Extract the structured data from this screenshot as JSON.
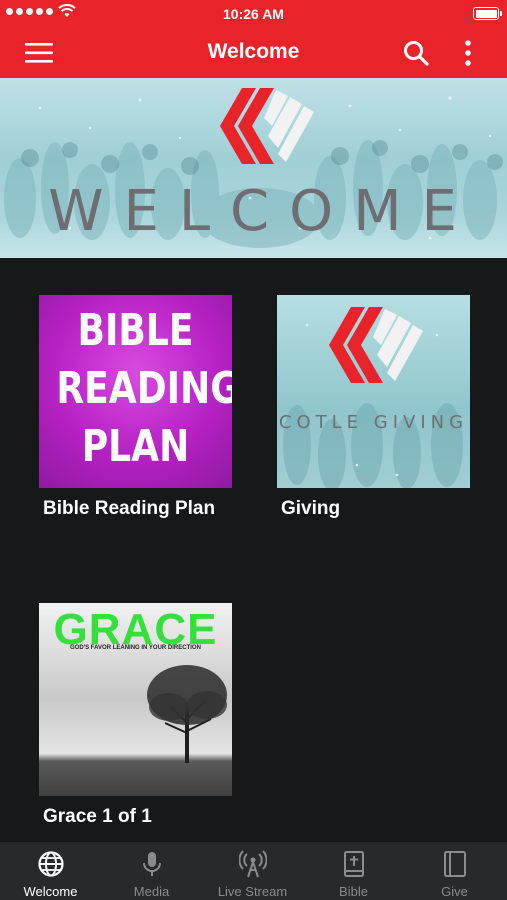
{
  "status_bar": {
    "time": "10:26 AM"
  },
  "app_bar": {
    "title": "Welcome",
    "menu_icon": "hamburger-menu-icon",
    "search_icon": "search-icon",
    "more_icon": "more-vert-icon",
    "color": "#e8232a"
  },
  "hero": {
    "title": "WELCOME",
    "logo_icon": "church-chevron-logo"
  },
  "grid": {
    "items": [
      {
        "label": "Bible Reading Plan",
        "image_lines": [
          "BIBLE",
          "READING",
          "PLAN"
        ]
      },
      {
        "label": "Giving",
        "image_caption": "COTLE GIVING"
      },
      {
        "label": "Grace 1 of 1",
        "image_word": "GRACE",
        "image_subtitle": "GOD'S FAVOR LEANING IN YOUR DIRECTION"
      }
    ]
  },
  "tab_bar": {
    "active": "Welcome",
    "tabs": [
      {
        "label": "Welcome",
        "icon": "globe-icon"
      },
      {
        "label": "Media",
        "icon": "microphone-icon"
      },
      {
        "label": "Live Stream",
        "icon": "broadcast-antenna-icon"
      },
      {
        "label": "Bible",
        "icon": "bible-book-icon"
      },
      {
        "label": "Give",
        "icon": "give-book-icon"
      }
    ]
  },
  "colors": {
    "accent": "#e8232a",
    "background": "#17181a",
    "tab_bar": "#28292b",
    "tab_inactive": "#8a8b8e",
    "tab_active": "#ffffff"
  }
}
